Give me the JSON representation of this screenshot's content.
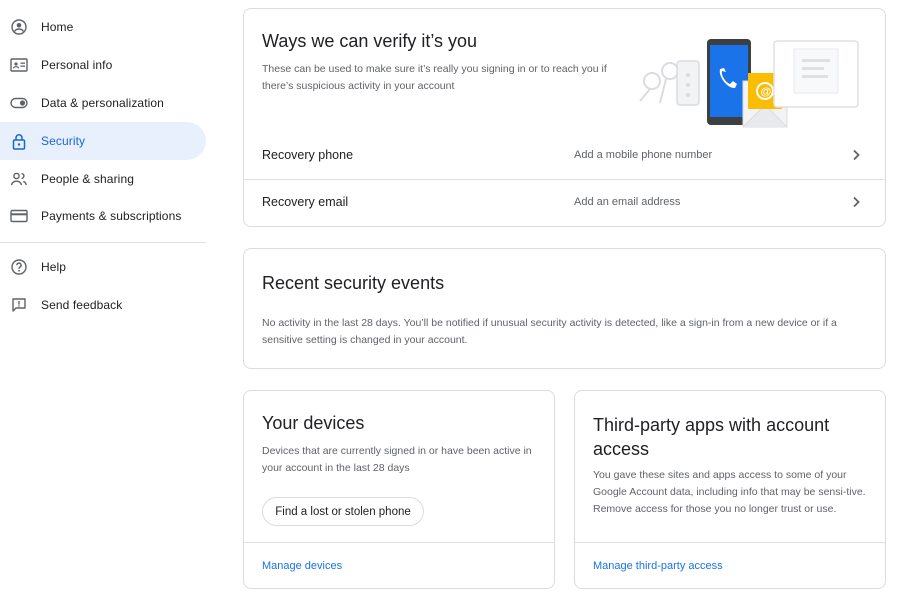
{
  "sidebar": {
    "items": [
      {
        "label": "Home",
        "icon": "account-circle-icon"
      },
      {
        "label": "Personal info",
        "icon": "id-card-icon"
      },
      {
        "label": "Data & personalization",
        "icon": "toggle-icon"
      },
      {
        "label": "Security",
        "icon": "lock-icon",
        "active": true
      },
      {
        "label": "People & sharing",
        "icon": "people-icon"
      },
      {
        "label": "Payments & subscriptions",
        "icon": "credit-card-icon"
      }
    ],
    "secondary": [
      {
        "label": "Help",
        "icon": "help-icon"
      },
      {
        "label": "Send feedback",
        "icon": "feedback-icon"
      }
    ]
  },
  "verify": {
    "title": "Ways we can verify it’s you",
    "description": "These can be used to make sure it’s really you signing in or to reach you if there’s suspicious activity in your account",
    "rows": [
      {
        "label": "Recovery phone",
        "value": "Add a mobile phone number"
      },
      {
        "label": "Recovery email",
        "value": "Add an email address"
      }
    ]
  },
  "events": {
    "title": "Recent security events",
    "description": "No activity in the last 28 days. You’ll be notified if unusual security activity is detected, like a sign-in from a new device or if a sensitive setting is changed in your account."
  },
  "devices": {
    "title": "Your devices",
    "description": "Devices that are currently signed in or have been active in your account in the last 28 days",
    "button": "Find a lost or stolen phone",
    "link": "Manage devices"
  },
  "thirdparty": {
    "title": "Third-party apps with account access",
    "description": "You gave these sites and apps access to some of your Google Account data, including info that may be sensi-tive. Remove access for those you no longer trust or use.",
    "link": "Manage third-party access"
  },
  "colors": {
    "accent": "#1a73e8",
    "active_bg": "#e8f0fe",
    "border": "#dadce0"
  }
}
